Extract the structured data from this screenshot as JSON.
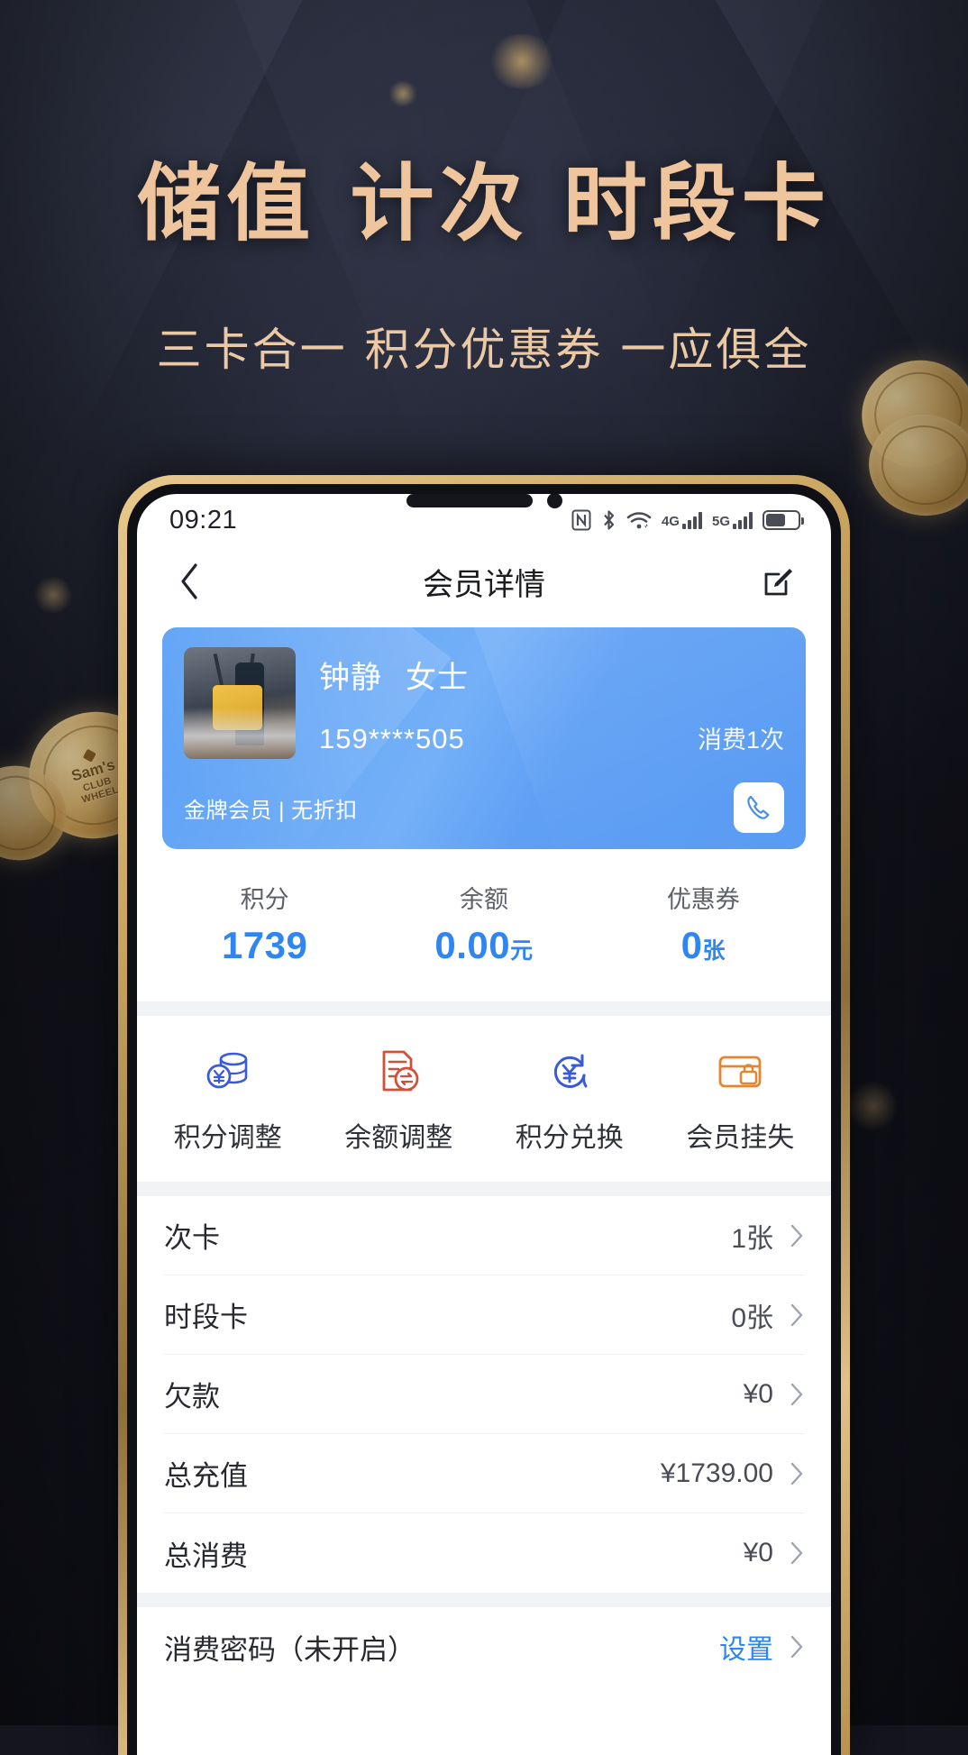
{
  "promo": {
    "headline": "储值 计次 时段卡",
    "subline": "三卡合一  积分优惠券  一应俱全",
    "headline_color": "#eec59c",
    "coin_brand_top": "Sam's",
    "coin_brand_mid": "CLUB",
    "coin_brand_bot": "WHEEL"
  },
  "statusbar": {
    "time": "09:21",
    "icons": [
      "nfc-icon",
      "bluetooth-icon",
      "wifi-icon",
      "signal-4g-icon",
      "signal-5g-icon",
      "battery-icon"
    ],
    "net_4g": "4G",
    "net_5g": "5G"
  },
  "navbar": {
    "title": "会员详情",
    "back_icon": "chevron-left-icon",
    "edit_icon": "edit-pencil-icon"
  },
  "member_card": {
    "name": "钟静",
    "honorific": "女士",
    "phone": "159****505",
    "visits": "消费1次",
    "level": "金牌会员 | 无折扣",
    "call_icon": "phone-icon",
    "card_color": "#63a4f5"
  },
  "stats": [
    {
      "label": "积分",
      "value": "1739",
      "unit": ""
    },
    {
      "label": "余额",
      "value": "0.00",
      "unit": "元"
    },
    {
      "label": "优惠券",
      "value": "0",
      "unit": "张"
    }
  ],
  "stat_accent": "#2f86f0",
  "actions": [
    {
      "label": "积分调整",
      "icon": "coins-stack-icon",
      "color": "#3a5bd9"
    },
    {
      "label": "余额调整",
      "icon": "document-exchange-icon",
      "color": "#d0503a"
    },
    {
      "label": "积分兑换",
      "icon": "yuan-refresh-icon",
      "color": "#3a5bd9"
    },
    {
      "label": "会员挂失",
      "icon": "card-lock-icon",
      "color": "#e4862f"
    }
  ],
  "list": [
    {
      "title": "次卡",
      "value": "1张",
      "link": false
    },
    {
      "title": "时段卡",
      "value": "0张",
      "link": false
    },
    {
      "title": "欠款",
      "value": "¥0",
      "link": false
    },
    {
      "title": "总充值",
      "value": "¥1739.00",
      "link": false
    },
    {
      "title": "总消费",
      "value": "¥0",
      "link": false
    }
  ],
  "password_row": {
    "title": "消费密码（未开启）",
    "value": "设置",
    "link": true
  }
}
